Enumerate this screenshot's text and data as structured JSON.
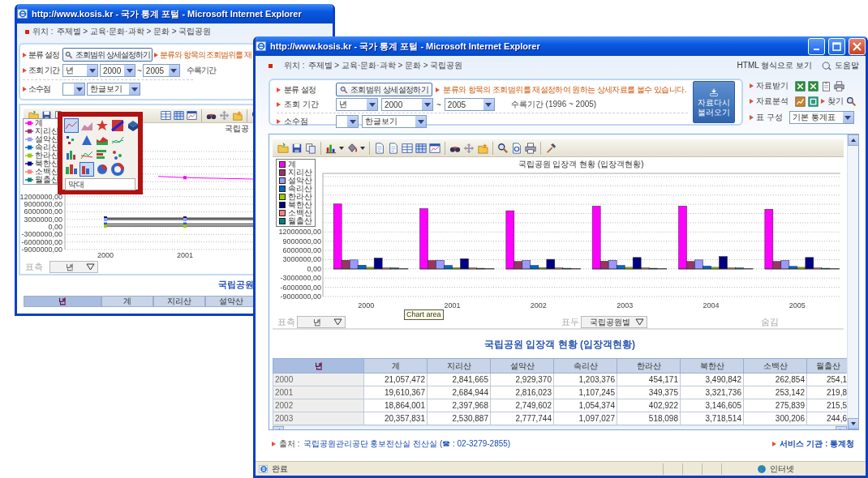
{
  "back_window": {
    "title": "http://www.kosis.kr - 국가 통계 포털 - Microsoft Internet Explorer",
    "breadcrumb_label": "위치 :",
    "breadcrumb": "주제별 > 교육·문화·과학 > 문화 > 국립공원",
    "filters": {
      "category_label": "분류 설정",
      "category_button": "조회범위 상세설정하기",
      "category_note": "분류와 항목의 조회범위를 재",
      "period_label": "조회 기간",
      "period_unit": "년",
      "period_from": "2000",
      "period_separator": "~",
      "period_to": "2005",
      "period_note": "수록기간",
      "decimal_label": "소수점",
      "view_mode": "한글보기"
    },
    "chart_type_menu": {
      "options": [
        {
          "selected": true
        },
        {
          "selected": false
        },
        {
          "selected": false
        },
        {
          "selected": false
        },
        {
          "selected": false
        },
        {
          "selected": false
        },
        {
          "selected": false
        },
        {
          "selected": false
        },
        {
          "selected": false
        },
        {
          "selected": false
        },
        {
          "selected": false
        },
        {
          "selected": false
        },
        {
          "selected": false
        },
        {
          "selected": false
        },
        {
          "selected": true
        },
        {
          "selected": false
        },
        {
          "selected": false
        }
      ],
      "field_value": "막대"
    },
    "chart": {
      "title": "국립공",
      "legend": [
        {
          "name": "계",
          "color": "#ff00ff"
        },
        {
          "name": "지리산",
          "color": "#993366"
        },
        {
          "name": "설악산",
          "color": "#9999ff"
        },
        {
          "name": "속리산",
          "color": "#0066cc"
        },
        {
          "name": "한라산",
          "color": "#99cc00"
        },
        {
          "name": "북한산",
          "color": "#000080"
        },
        {
          "name": "소백산",
          "color": "#ff8080"
        },
        {
          "name": "월출산",
          "color": "#008080"
        }
      ],
      "y_axis_labels": [
        "12000000,00",
        "9000000,00",
        "6000000,00",
        "3000000,00",
        "0,00",
        "-3000000,00",
        "-6000000,00",
        "-9000000,00"
      ],
      "x_axis_labels": [
        "2000",
        "2001"
      ]
    },
    "pivot": {
      "row_label": "표측",
      "row_value": "년"
    },
    "table_title": "국립공원",
    "table_columns": [
      "년",
      "계",
      "지리산",
      "설악산"
    ]
  },
  "front_window": {
    "title": "http://www.kosis.kr - 국가 통계 포털 - Microsoft Internet Explorer",
    "breadcrumb_label": "위치 :",
    "breadcrumb": "주제별 > 교육·문화·과학 > 문화 > 국립공원",
    "html_view_link": "HTML 형식으로 보기",
    "help_link": "도움말",
    "filters": {
      "category_label": "분류 설정",
      "category_button": "조회범위 상세설정하기",
      "category_note": "분류와 항목의 조회범위를 재설정하여 원하는 상세자료를 볼수 있습니다.",
      "period_label": "조회 기간",
      "period_unit": "년",
      "period_from": "2000",
      "period_separator": "~",
      "period_to": "2005",
      "period_note": "수록기간 (1996 ~ 2005)",
      "decimal_label": "소수점",
      "view_mode": "한글보기"
    },
    "reload_button": "자료다시 불러오기",
    "side_tools": {
      "download_label": "자료받기",
      "analysis_label": "자료분석",
      "find_label": "찾기",
      "layout_label": "표 구성",
      "layout_value": "기본 통계표"
    },
    "chart": {
      "chart_data": {
        "type": "bar",
        "title": "국립공원 입장객 현황 (입장객현황)",
        "categories": [
          "2000",
          "2001",
          "2002",
          "2003",
          "2004",
          "2005"
        ],
        "series": [
          {
            "name": "계",
            "color": "#ff00ff",
            "values": [
              21100000,
              19600000,
              18900000,
              20400000,
              20400000,
              19400000
            ]
          },
          {
            "name": "지리산",
            "color": "#993366",
            "values": [
              2800000,
              2700000,
              2400000,
              2500000,
              2400000,
              2400000
            ]
          },
          {
            "name": "설악산",
            "color": "#9999ff",
            "values": [
              2900000,
              2800000,
              2700000,
              2800000,
              2900000,
              2700000
            ]
          },
          {
            "name": "속리산",
            "color": "#0066cc",
            "values": [
              1200000,
              1100000,
              1100000,
              1100000,
              900000,
              800000
            ]
          },
          {
            "name": "한라산",
            "color": "#99cc00",
            "values": [
              500000,
              300000,
              400000,
              500000,
              500000,
              500000
            ]
          },
          {
            "name": "북한산",
            "color": "#000080",
            "values": [
              3500000,
              3300000,
              3100000,
              3700000,
              4000000,
              3700000
            ]
          },
          {
            "name": "소백산",
            "color": "#ff8080",
            "values": [
              300000,
              300000,
              300000,
              300000,
              300000,
              300000
            ]
          },
          {
            "name": "월출산",
            "color": "#008080",
            "values": [
              300000,
              200000,
              200000,
              200000,
              300000,
              200000
            ]
          }
        ],
        "ylim": [
          -9000000,
          30000000
        ],
        "grid": true,
        "legend": true,
        "yticks": [
          {
            "value": 12000000,
            "label": "12000000,00"
          },
          {
            "value": 9000000,
            "label": "9000000,00"
          },
          {
            "value": 6000000,
            "label": "6000000,00"
          },
          {
            "value": 3000000,
            "label": "3000000,00"
          },
          {
            "value": 0,
            "label": "0,00"
          },
          {
            "value": -3000000,
            "label": "-3000000,00"
          },
          {
            "value": -6000000,
            "label": "-6000000,00"
          },
          {
            "value": -9000000,
            "label": "-9000000,00"
          }
        ]
      },
      "tooltip": "Chart area"
    },
    "pivot": {
      "row_label": "표측",
      "row_value": "년",
      "column_label": "표두",
      "column_value": "국립공원별",
      "hidden_label": "숨김"
    },
    "table": {
      "title": "국립공원 입장객 현황 (입장객현황)",
      "columns": [
        "년",
        "계",
        "지리산",
        "설악산",
        "속리산",
        "한라산",
        "북한산",
        "소백산",
        "월출산"
      ],
      "rows": [
        [
          "2000",
          "21,057,472",
          "2,841,665",
          "2,929,370",
          "1,203,376",
          "454,171",
          "3,490,842",
          "262,854",
          "254,1"
        ],
        [
          "2001",
          "19,610,367",
          "2,684,944",
          "2,816,023",
          "1,107,245",
          "349,375",
          "3,321,736",
          "253,142",
          "219,8"
        ],
        [
          "2002",
          "18,864,001",
          "2,397,968",
          "2,749,602",
          "1,054,374",
          "402,922",
          "3,146,605",
          "275,839",
          "215,5"
        ],
        [
          "2003",
          "20,357,831",
          "2,530,887",
          "2,777,744",
          "1,097,027",
          "518,098",
          "3,718,514",
          "300,206",
          "244,6"
        ]
      ]
    },
    "source_label": "출처 :",
    "source": "국립공원관리공단 홍보전산실 전산실 (☎ : 02-3279-2855)",
    "service": "서비스 기관 : 통계청",
    "status_bar": {
      "status": "완료",
      "zone": "인터넷"
    }
  }
}
